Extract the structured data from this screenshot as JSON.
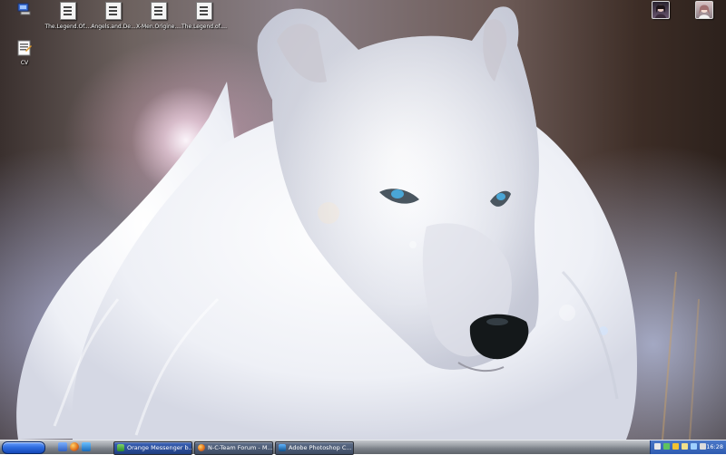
{
  "desktop": {
    "icons": [
      {
        "label": "",
        "icon": "my-computer-icon"
      },
      {
        "label": "The.Legend.Of....",
        "icon": "document-icon"
      },
      {
        "label": "Angels.and.De...",
        "icon": "document-icon"
      },
      {
        "label": "X-Men.Origine....",
        "icon": "document-icon"
      },
      {
        "label": "The.Legend.of....",
        "icon": "document-icon"
      },
      {
        "label": "CV",
        "icon": "text-document-icon"
      }
    ],
    "shortcuts": [
      {
        "icon": "avatar-girl-icon"
      },
      {
        "icon": "avatar-doll-icon"
      }
    ],
    "wallpaper": "white-wolf-wallpaper"
  },
  "taskbar": {
    "start_button": {
      "icon": "start-button-icon"
    },
    "quick_launch": [
      {
        "icon": "show-desktop-icon"
      },
      {
        "icon": "firefox-icon"
      },
      {
        "icon": "media-icon"
      }
    ],
    "tasks": [
      {
        "label": "Orange Messenger b...",
        "icon": "messenger-icon",
        "active": true
      },
      {
        "label": "N-C-Team Forum - M...",
        "icon": "firefox-icon",
        "active": false
      },
      {
        "label": "Adobe Photoshop C...",
        "icon": "photoshop-icon",
        "active": false
      }
    ],
    "tray": {
      "icons": [
        "network-icon",
        "messenger-tray-icon",
        "shield-tray-icon",
        "folder-tray-icon",
        "sync-tray-icon",
        "volume-icon"
      ],
      "clock": "16:28"
    }
  },
  "colors": {
    "taskbar_silver": "#9da2a8",
    "start_blue": "#2f6de0",
    "tray_blue": "#2e5bb0",
    "active_task": "#1f3d80"
  }
}
